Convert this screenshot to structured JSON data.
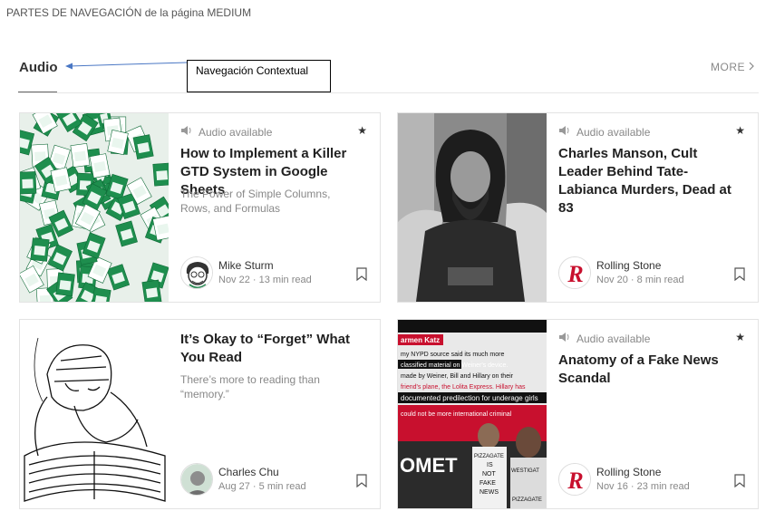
{
  "page": {
    "caption": "PARTES DE NAVEGACIÓN de la página MEDIUM"
  },
  "section": {
    "title": "Audio",
    "more_label": "MORE"
  },
  "annotation": {
    "label": "Navegación Contextual"
  },
  "cards": [
    {
      "audio_label": "Audio available",
      "title": "How to Implement a Killer GTD System in Google Sheets",
      "subtitle": "The Power of Simple Columns, Rows, and Formulas",
      "author": "Mike Sturm",
      "date": "Nov 22",
      "read_time": "13 min read",
      "image": "spreadsheet-collage"
    },
    {
      "audio_label": "Audio available",
      "title": "Charles Manson, Cult Leader Behind Tate-Labianca Murders, Dead at 83",
      "subtitle": "",
      "author": "Rolling Stone",
      "date": "Nov 20",
      "read_time": "8 min read",
      "image": "bw-photo"
    },
    {
      "audio_label": "",
      "title": "It’s Okay to “Forget” What You Read",
      "subtitle": "There’s more to reading than “memory.”",
      "author": "Charles Chu",
      "date": "Aug 27",
      "read_time": "5 min read",
      "image": "sketch-reader"
    },
    {
      "audio_label": "Audio available",
      "title": "Anatomy of a Fake News Scandal",
      "subtitle": "",
      "author": "Rolling Stone",
      "date": "Nov 16",
      "read_time": "23 min read",
      "image": "news-collage"
    }
  ],
  "card_image_text": {
    "c4": [
      "armen Katz",
      "my NYPD source said its much more",
      "classified material on Weiner's device.",
      "made by Weiner, Bill and Hillary on their",
      "friend's plane, the Lolita Express. Hillary has",
      "documented predilection for underage girls",
      "could not be more international criminal",
      "OMET",
      "PIZZAGATE",
      "IS",
      "NOT",
      "FAKE",
      "NEWS",
      "WESTIGAT",
      "PIZZAGATE"
    ]
  },
  "icons": {
    "audio": "speaker-icon",
    "star": "star-icon",
    "bookmark": "bookmark-icon",
    "more": "chevron-right-icon"
  },
  "colors": {
    "title": "#222222",
    "muted": "#888888",
    "border": "#e3e3e3",
    "rolling_red": "#c8102e"
  }
}
